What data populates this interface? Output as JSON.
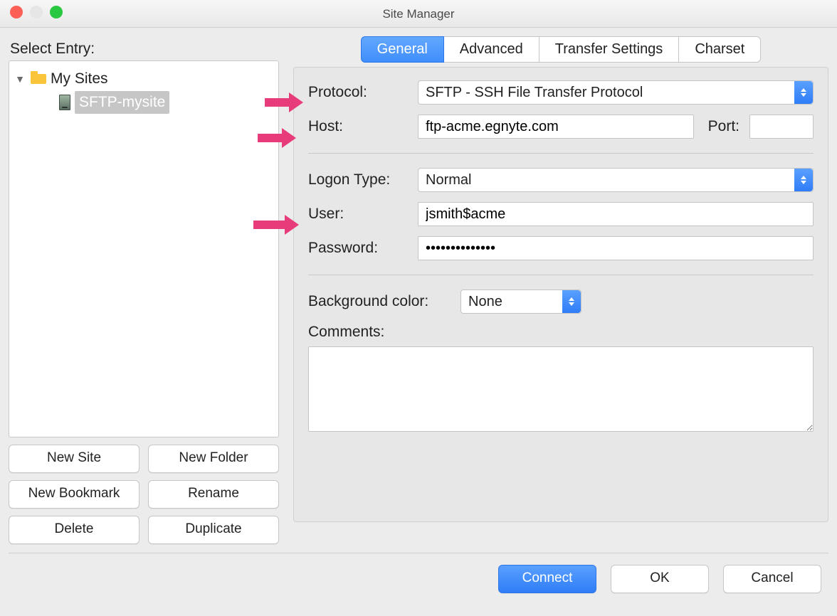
{
  "window": {
    "title": "Site Manager"
  },
  "sidebar": {
    "label": "Select Entry:",
    "root_folder": "My Sites",
    "selected_site": "SFTP-mysite",
    "buttons": {
      "new_site": "New Site",
      "new_folder": "New Folder",
      "new_bookmark": "New Bookmark",
      "rename": "Rename",
      "delete": "Delete",
      "duplicate": "Duplicate"
    }
  },
  "tabs": {
    "general": "General",
    "advanced": "Advanced",
    "transfer": "Transfer Settings",
    "charset": "Charset"
  },
  "form": {
    "protocol_label": "Protocol:",
    "protocol_value": "SFTP - SSH File Transfer Protocol",
    "host_label": "Host:",
    "host_value": "ftp-acme.egnyte.com",
    "port_label": "Port:",
    "port_value": "",
    "logon_type_label": "Logon Type:",
    "logon_type_value": "Normal",
    "user_label": "User:",
    "user_value": "jsmith$acme",
    "password_label": "Password:",
    "password_value": "••••••••••••••",
    "bg_color_label": "Background color:",
    "bg_color_value": "None",
    "comments_label": "Comments:",
    "comments_value": ""
  },
  "footer": {
    "connect": "Connect",
    "ok": "OK",
    "cancel": "Cancel"
  }
}
